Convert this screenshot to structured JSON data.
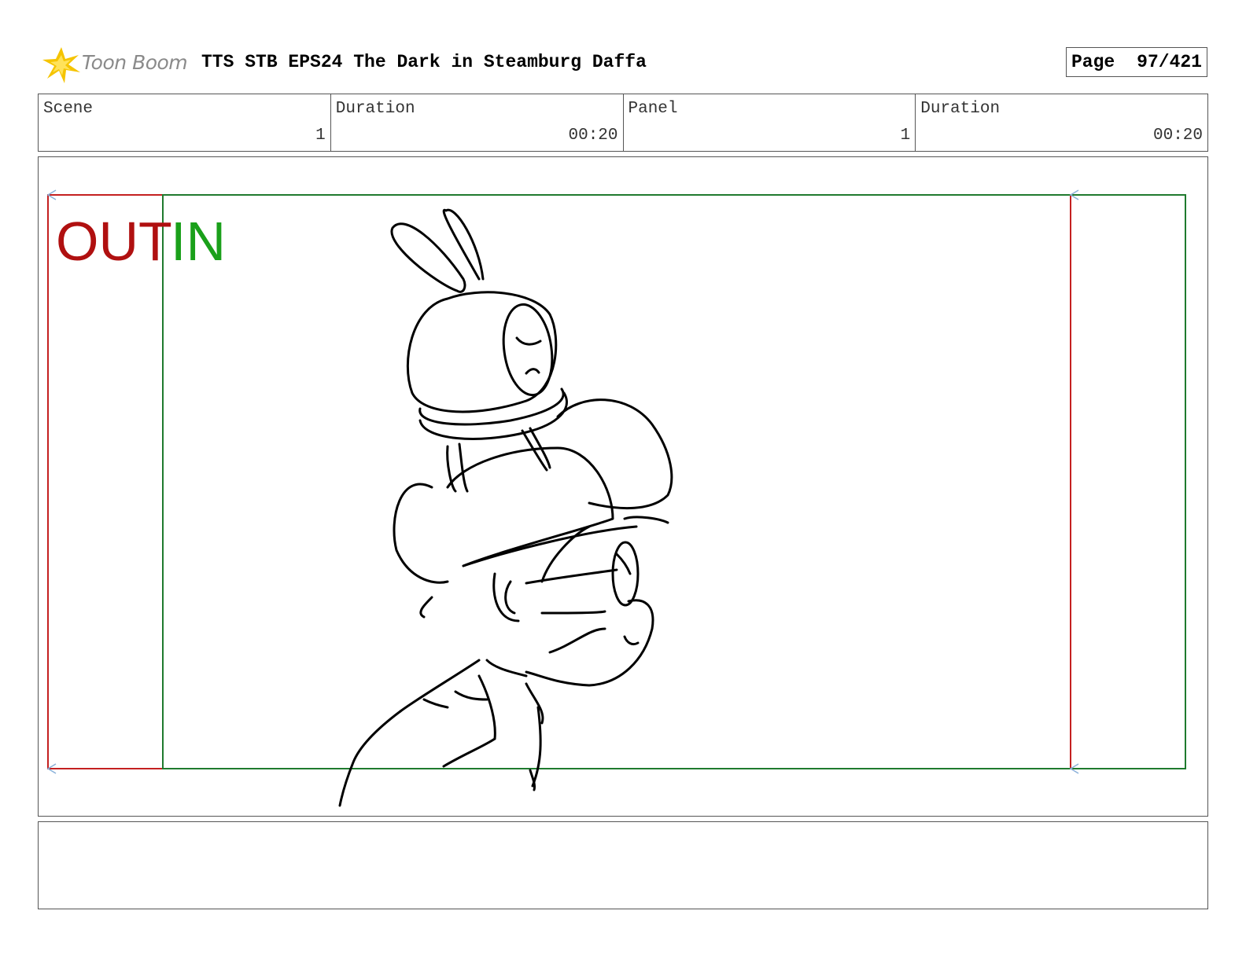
{
  "header": {
    "logo_text": "Toon Boom",
    "title": "TTS STB EPS24 The Dark in Steamburg Daffa",
    "page_label": "Page",
    "page_value": "97/421"
  },
  "info": {
    "scene_label": "Scene",
    "scene_value": "1",
    "scene_duration_label": "Duration",
    "scene_duration_value": "00:20",
    "panel_label": "Panel",
    "panel_value": "1",
    "panel_duration_label": "Duration",
    "panel_duration_value": "00:20"
  },
  "panel": {
    "out_text": "OUT",
    "in_text": "IN",
    "out_color": "#b01010",
    "in_color": "#1aa01a"
  },
  "caption": {
    "text": ""
  }
}
